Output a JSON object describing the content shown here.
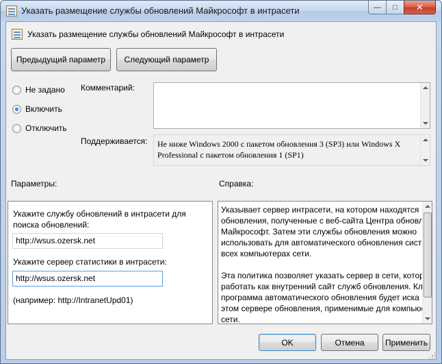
{
  "window": {
    "title": "Указать размещение службы обновлений Майкрософт в интрасети",
    "minimize_glyph": "—",
    "maximize_glyph": "□",
    "close_glyph": "✕"
  },
  "header": {
    "title": "Указать размещение службы обновлений Майкрософт в интрасети",
    "icon": "policy-setting-icon"
  },
  "nav": {
    "prev_label": "Предыдущий параметр",
    "next_label": "Следующий параметр"
  },
  "state": {
    "options": [
      "Не задано",
      "Включить",
      "Отключить"
    ],
    "selected": "Включить"
  },
  "comment": {
    "label": "Комментарий:",
    "value": ""
  },
  "supported": {
    "label": "Поддерживается:",
    "line1": "Не ниже Windows 2000 с пакетом обновления 3 (SP3) или Windows X",
    "line2": "Professional с пакетом обновления 1 (SP1)"
  },
  "options_section": {
    "label": "Параметры:",
    "update_service_label_1": "Укажите службу обновлений в интрасети для",
    "update_service_label_2": "поиска обновлений:",
    "update_service_value": "http://wsus.ozersk.net",
    "stats_server_label": "Укажите сервер статистики в интрасети:",
    "stats_server_value": "http://wsus.ozersk.net",
    "example": "(например: http://IntranetUpd01)"
  },
  "help_section": {
    "label": "Справка:",
    "lines": [
      "Указывает сервер интрасети, на котором находятся",
      "обновления, полученные с веб-сайта Центра обновл",
      "Майкрософт. Затем эти службы обновления можно",
      "использовать для автоматического обновления сист",
      "всех компьютерах сети.",
      "",
      "Эта политика позволяет указать сервер в сети, которі",
      "работать как внутренний сайт служб обновления. Кл",
      "программа автоматического обновления будет иска",
      "этом сервере обновления, применимые для компьюс",
      "сети."
    ]
  },
  "footer": {
    "ok_label": "OK",
    "cancel_label": "Отмена",
    "apply_label": "Применить"
  }
}
